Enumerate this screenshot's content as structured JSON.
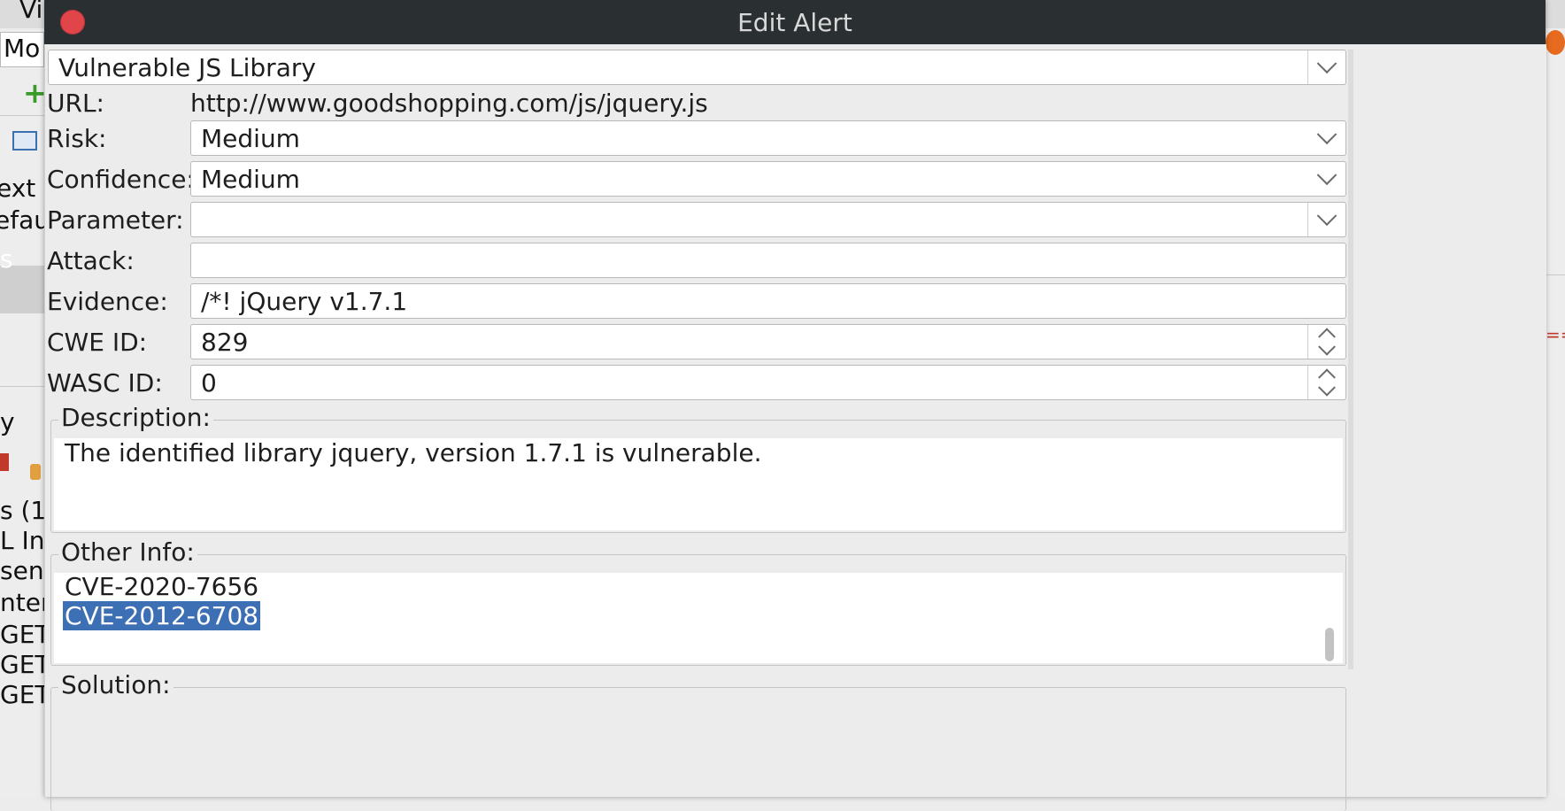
{
  "window_title": "Edit Alert",
  "background": {
    "left_fragments": [
      "Vi",
      "Mo",
      "ext",
      "efau",
      "s",
      "y",
      "s (1",
      "L In",
      "sen",
      "nter",
      "GET",
      "GET",
      "GET"
    ]
  },
  "alert": {
    "name_value": "Vulnerable JS Library",
    "url_label": "URL:",
    "url_value": "http://www.goodshopping.com/js/jquery.js",
    "risk_label": "Risk:",
    "risk_value": "Medium",
    "confidence_label": "Confidence:",
    "confidence_value": "Medium",
    "parameter_label": "Parameter:",
    "parameter_value": "",
    "attack_label": "Attack:",
    "attack_value": "",
    "evidence_label": "Evidence:",
    "evidence_value": "/*! jQuery v1.7.1",
    "cwe_label": "CWE ID:",
    "cwe_value": "829",
    "wasc_label": "WASC ID:",
    "wasc_value": "0",
    "description_label": "Description:",
    "description_text": "The identified library jquery, version 1.7.1 is vulnerable.",
    "other_info_label": "Other Info:",
    "other_info_lines": [
      "CVE-2020-7656",
      "CVE-2012-6708"
    ],
    "solution_label": "Solution:"
  },
  "colors": {
    "titlebar": "#2a2f31",
    "close_button": "#e0454a",
    "selection": "#3d6fb4"
  }
}
